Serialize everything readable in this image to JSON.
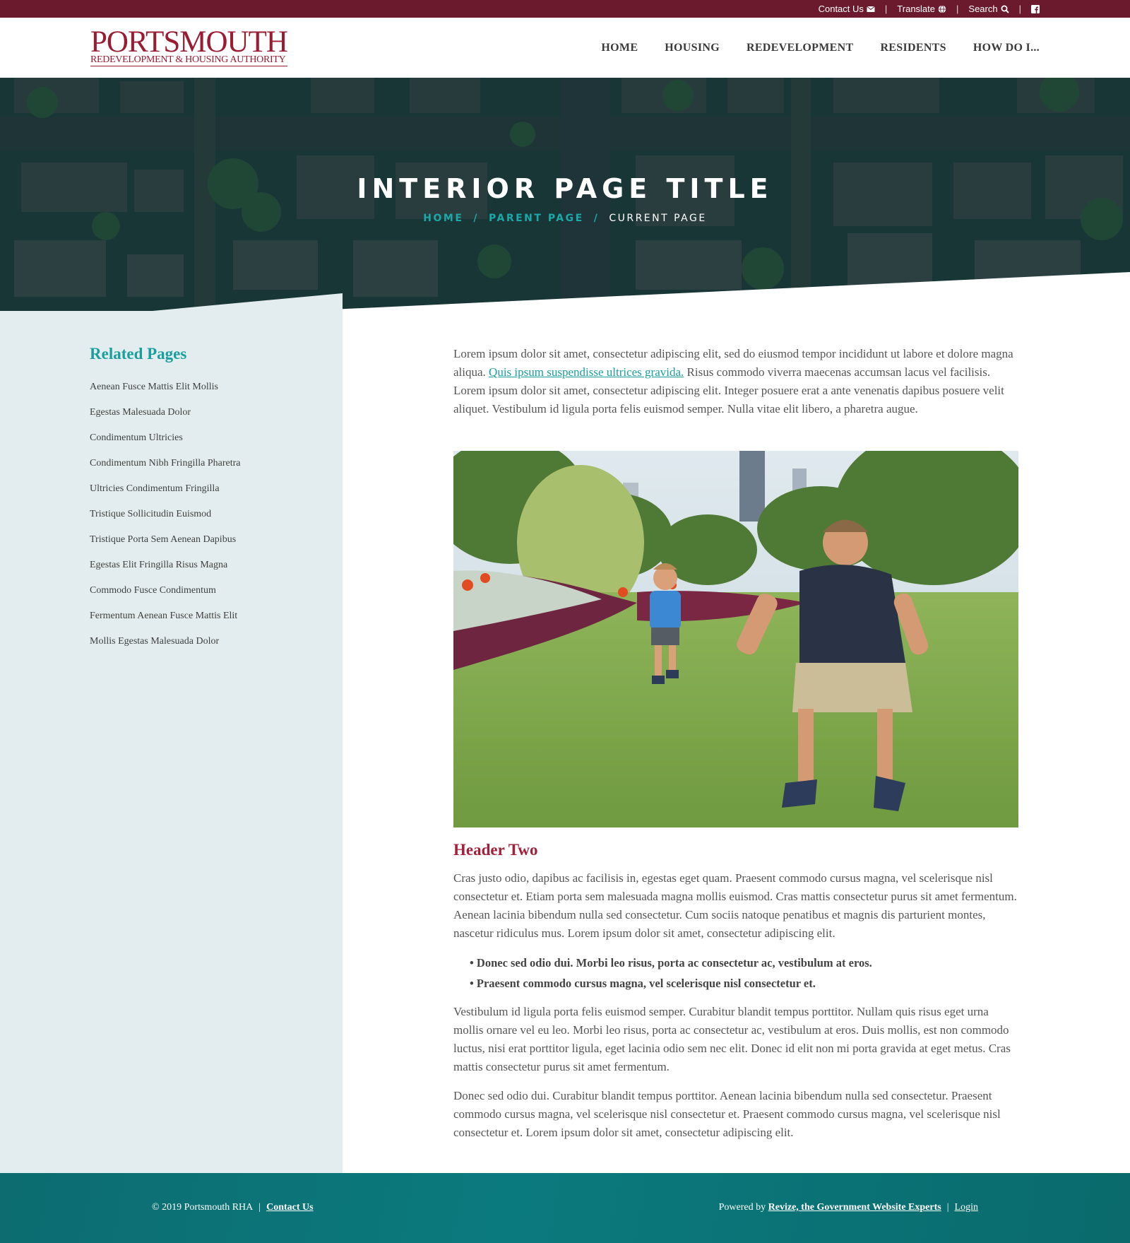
{
  "utility": {
    "contact": "Contact Us",
    "translate": "Translate",
    "search": "Search",
    "separator": "|"
  },
  "logo": {
    "main": "PORTSMOUTH",
    "sub": "REDEVELOPMENT & HOUSING AUTHORITY"
  },
  "nav": {
    "items": [
      "HOME",
      "HOUSING",
      "REDEVELOPMENT",
      "RESIDENTS",
      "HOW DO I..."
    ]
  },
  "hero": {
    "title": "INTERIOR PAGE TITLE",
    "breadcrumb": {
      "home": "HOME",
      "parent": "PARENT PAGE",
      "current": "CURRENT PAGE",
      "separator": "/"
    }
  },
  "sidebar": {
    "title": "Related Pages",
    "items": [
      "Aenean Fusce Mattis Elit Mollis",
      "Egestas Malesuada Dolor",
      "Condimentum Ultricies",
      "Condimentum Nibh Fringilla Pharetra",
      "Ultricies Condimentum Fringilla",
      "Tristique Sollicitudin Euismod",
      "Tristique Porta Sem Aenean Dapibus",
      "Egestas Elit Fringilla Risus Magna",
      "Commodo Fusce Condimentum",
      "Fermentum Aenean Fusce Mattis Elit",
      "Mollis Egestas Malesuada Dolor"
    ]
  },
  "content": {
    "intro_before": "Lorem ipsum dolor sit amet, consectetur adipiscing elit, sed do eiusmod tempor incididunt ut labore et dolore magna aliqua. ",
    "intro_link": "Quis ipsum suspendisse ultrices gravida.",
    "intro_after": " Risus commodo viverra maecenas accumsan lacus vel facilisis. Lorem ipsum dolor sit amet, consectetur adipiscing elit. Integer posuere erat a ante venenatis dapibus posuere velit aliquet. Vestibulum id ligula porta felis euismod semper. Nulla vitae elit libero, a pharetra augue.",
    "header_two": "Header Two",
    "para2": "Cras justo odio, dapibus ac facilisis in, egestas eget quam. Praesent commodo cursus magna, vel scelerisque nisl consectetur et. Etiam porta sem malesuada magna mollis euismod. Cras mattis consectetur purus sit amet fermentum. Aenean lacinia bibendum nulla sed consectetur. Cum sociis natoque penatibus et magnis dis parturient montes, nascetur ridiculus mus. Lorem ipsum dolor sit amet, consectetur adipiscing elit.",
    "bullets": [
      "• Donec sed odio dui. Morbi leo risus, porta ac consectetur ac, vestibulum at eros.",
      "• Praesent commodo cursus magna, vel scelerisque nisl consectetur et."
    ],
    "para3": "Vestibulum id ligula porta felis euismod semper. Curabitur blandit tempus porttitor. Nullam quis risus eget urna mollis ornare vel eu leo. Morbi leo risus, porta ac consectetur ac, vestibulum at eros. Duis mollis, est non commodo luctus, nisi erat porttitor ligula, eget lacinia odio sem nec elit. Donec id elit non mi porta gravida at eget metus. Cras mattis consectetur purus sit amet fermentum.",
    "para4": "Donec sed odio dui. Curabitur blandit tempus porttitor. Aenean lacinia bibendum nulla sed consectetur. Praesent commodo cursus magna, vel scelerisque nisl consectetur et. Praesent commodo cursus magna, vel scelerisque nisl consectetur et. Lorem ipsum dolor sit amet, consectetur adipiscing elit."
  },
  "footer": {
    "copyright": "© 2019 Portsmouth RHA",
    "contact": "Contact Us",
    "powered_by": "Powered by",
    "revize": "Revize, the Government Website Experts",
    "login": "Login",
    "separator": "|"
  },
  "colors": {
    "utility_bar": "#6b1a2d",
    "brand_red": "#9a1c33",
    "teal": "#1a9e9e",
    "sidebar_bg": "#e3edef",
    "footer_teal": "#0b7a7e"
  },
  "icons": [
    "envelope-icon",
    "globe-icon",
    "search-icon",
    "facebook-icon"
  ]
}
